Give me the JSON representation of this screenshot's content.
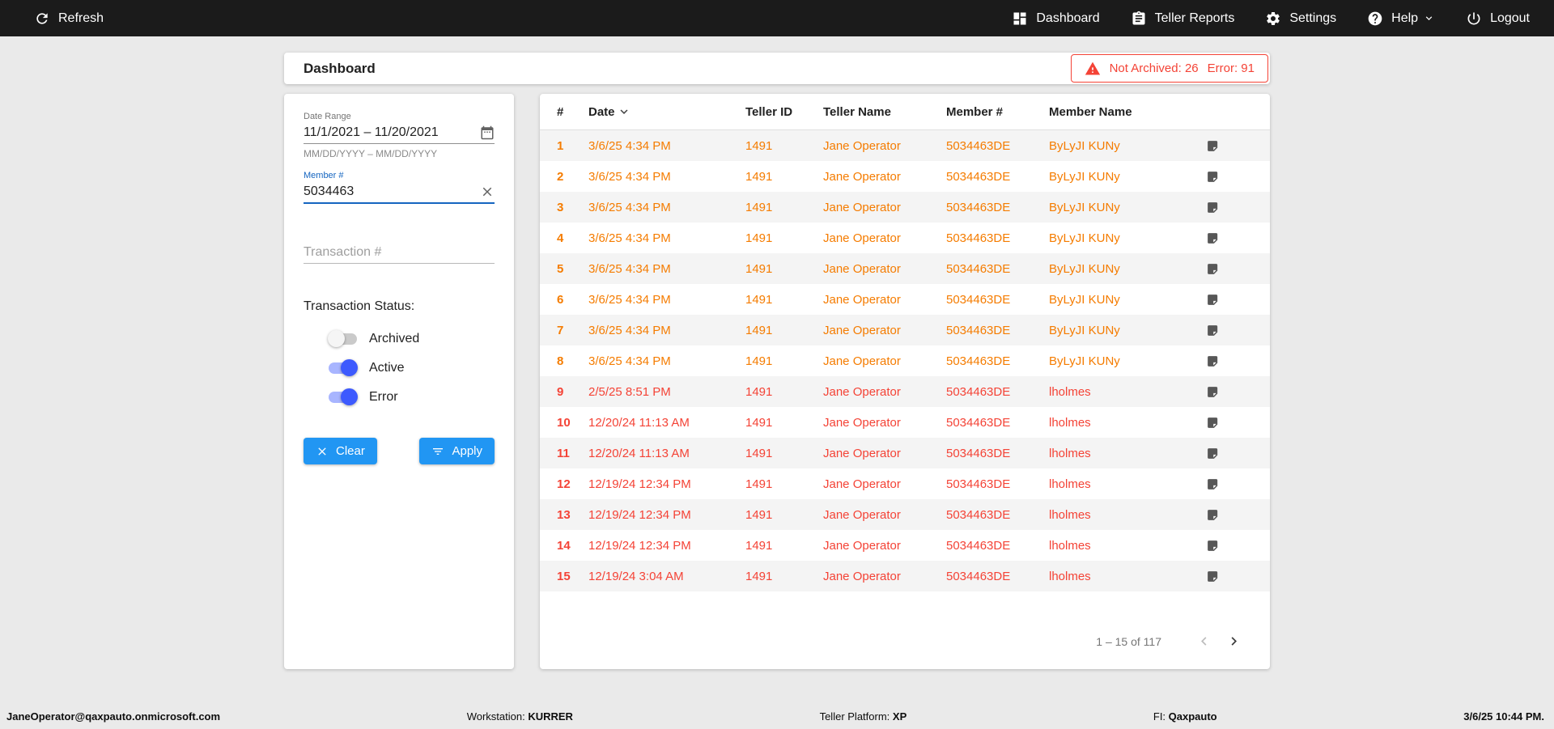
{
  "colors": {
    "accent": "#2196f3",
    "toggle_on": "#3d5afe",
    "active_row": "#f57c00",
    "error_row": "#f44336",
    "alert": "#f44336",
    "member_label": "#1565c0"
  },
  "topbar": {
    "refresh_label": "Refresh",
    "nav": [
      {
        "id": "dashboard",
        "label": "Dashboard",
        "icon": "dashboard-icon"
      },
      {
        "id": "teller-reports",
        "label": "Teller Reports",
        "icon": "teller-reports-icon"
      },
      {
        "id": "settings",
        "label": "Settings",
        "icon": "settings-icon"
      },
      {
        "id": "help",
        "label": "Help",
        "icon": "help-icon",
        "dropdown": true
      },
      {
        "id": "logout",
        "label": "Logout",
        "icon": "logout-icon"
      }
    ]
  },
  "header": {
    "title": "Dashboard",
    "alert": {
      "not_archived": "Not Archived: 26",
      "error": "Error: 91"
    }
  },
  "filters": {
    "date_range": {
      "label": "Date Range",
      "value": "11/1/2021 – 11/20/2021",
      "hint": "MM/DD/YYYY – MM/DD/YYYY"
    },
    "member": {
      "label": "Member #",
      "value": "5034463"
    },
    "transaction": {
      "placeholder": "Transaction #"
    },
    "status": {
      "label": "Transaction Status:",
      "toggles": [
        {
          "label": "Archived",
          "on": false
        },
        {
          "label": "Active",
          "on": true
        },
        {
          "label": "Error",
          "on": true
        }
      ]
    },
    "clear_label": "Clear",
    "apply_label": "Apply"
  },
  "table": {
    "columns": [
      "#",
      "Date",
      "Teller ID",
      "Teller Name",
      "Member #",
      "Member Name"
    ],
    "rows": [
      {
        "num": "1",
        "date": "3/6/25 4:34 PM",
        "teller_id": "1491",
        "teller_name": "Jane Operator",
        "member_num": "5034463DE",
        "member_name": "ByLyJI KUNy",
        "status": "active"
      },
      {
        "num": "2",
        "date": "3/6/25 4:34 PM",
        "teller_id": "1491",
        "teller_name": "Jane Operator",
        "member_num": "5034463DE",
        "member_name": "ByLyJI KUNy",
        "status": "active"
      },
      {
        "num": "3",
        "date": "3/6/25 4:34 PM",
        "teller_id": "1491",
        "teller_name": "Jane Operator",
        "member_num": "5034463DE",
        "member_name": "ByLyJI KUNy",
        "status": "active"
      },
      {
        "num": "4",
        "date": "3/6/25 4:34 PM",
        "teller_id": "1491",
        "teller_name": "Jane Operator",
        "member_num": "5034463DE",
        "member_name": "ByLyJI KUNy",
        "status": "active"
      },
      {
        "num": "5",
        "date": "3/6/25 4:34 PM",
        "teller_id": "1491",
        "teller_name": "Jane Operator",
        "member_num": "5034463DE",
        "member_name": "ByLyJI KUNy",
        "status": "active"
      },
      {
        "num": "6",
        "date": "3/6/25 4:34 PM",
        "teller_id": "1491",
        "teller_name": "Jane Operator",
        "member_num": "5034463DE",
        "member_name": "ByLyJI KUNy",
        "status": "active"
      },
      {
        "num": "7",
        "date": "3/6/25 4:34 PM",
        "teller_id": "1491",
        "teller_name": "Jane Operator",
        "member_num": "5034463DE",
        "member_name": "ByLyJI KUNy",
        "status": "active"
      },
      {
        "num": "8",
        "date": "3/6/25 4:34 PM",
        "teller_id": "1491",
        "teller_name": "Jane Operator",
        "member_num": "5034463DE",
        "member_name": "ByLyJI KUNy",
        "status": "active"
      },
      {
        "num": "9",
        "date": "2/5/25 8:51 PM",
        "teller_id": "1491",
        "teller_name": "Jane Operator",
        "member_num": "5034463DE",
        "member_name": "lholmes",
        "status": "error"
      },
      {
        "num": "10",
        "date": "12/20/24 11:13 AM",
        "teller_id": "1491",
        "teller_name": "Jane Operator",
        "member_num": "5034463DE",
        "member_name": "lholmes",
        "status": "error"
      },
      {
        "num": "11",
        "date": "12/20/24 11:13 AM",
        "teller_id": "1491",
        "teller_name": "Jane Operator",
        "member_num": "5034463DE",
        "member_name": "lholmes",
        "status": "error"
      },
      {
        "num": "12",
        "date": "12/19/24 12:34 PM",
        "teller_id": "1491",
        "teller_name": "Jane Operator",
        "member_num": "5034463DE",
        "member_name": "lholmes",
        "status": "error"
      },
      {
        "num": "13",
        "date": "12/19/24 12:34 PM",
        "teller_id": "1491",
        "teller_name": "Jane Operator",
        "member_num": "5034463DE",
        "member_name": "lholmes",
        "status": "error"
      },
      {
        "num": "14",
        "date": "12/19/24 12:34 PM",
        "teller_id": "1491",
        "teller_name": "Jane Operator",
        "member_num": "5034463DE",
        "member_name": "lholmes",
        "status": "error"
      },
      {
        "num": "15",
        "date": "12/19/24 3:04 AM",
        "teller_id": "1491",
        "teller_name": "Jane Operator",
        "member_num": "5034463DE",
        "member_name": "lholmes",
        "status": "error"
      }
    ],
    "pagination": {
      "range_label": "1 – 15 of 117"
    }
  },
  "footer": {
    "user_email": "JaneOperator@qaxpauto.onmicrosoft.com",
    "workstation_label": "Workstation:",
    "workstation_value": "KURRER",
    "platform_label": "Teller Platform:",
    "platform_value": "XP",
    "fi_label": "FI:",
    "fi_value": "Qaxpauto",
    "datetime": "3/6/25 10:44 PM."
  }
}
